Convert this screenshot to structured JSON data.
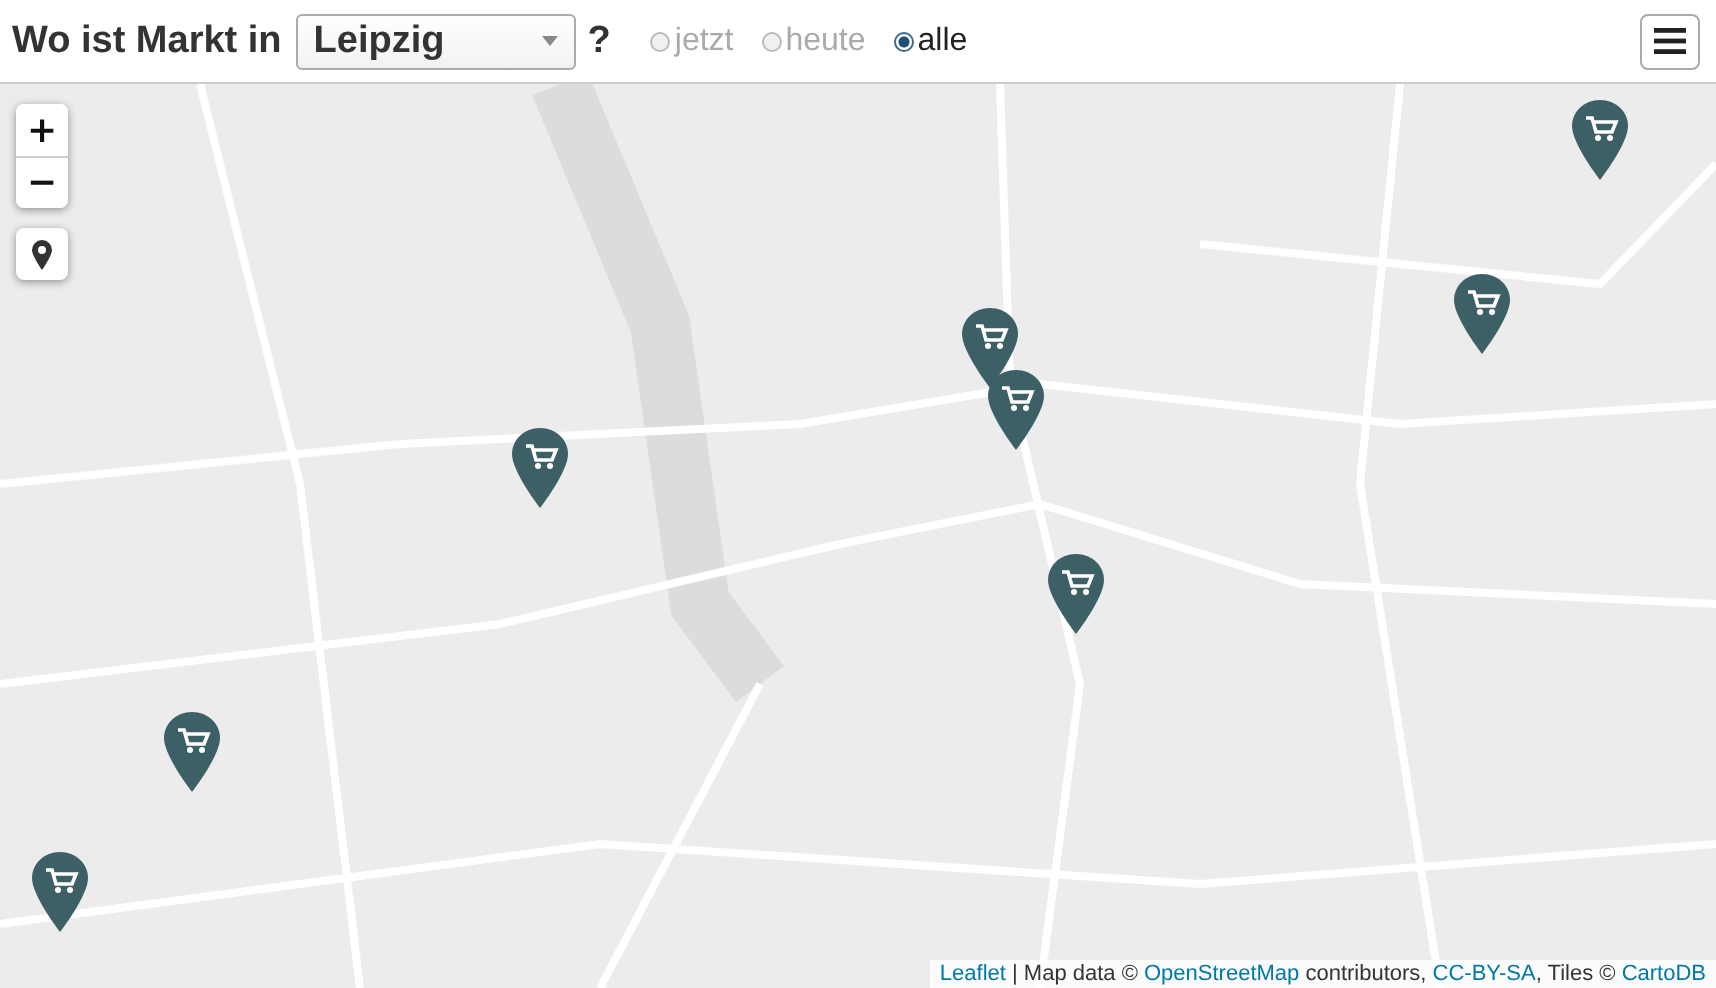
{
  "header": {
    "title": "Wo ist Markt in",
    "city_select": {
      "value": "Leipzig"
    },
    "help": "?",
    "time_filter": [
      {
        "label": "jetzt",
        "selected": false
      },
      {
        "label": "heute",
        "selected": false
      },
      {
        "label": "alle",
        "selected": true
      }
    ]
  },
  "map": {
    "zoom_in": "+",
    "zoom_out": "−",
    "attribution": [
      {
        "kind": "link",
        "text": "Leaflet"
      },
      {
        "kind": "text",
        "text": " | Map data © "
      },
      {
        "kind": "link",
        "text": "OpenStreetMap"
      },
      {
        "kind": "text",
        "text": " contributors, "
      },
      {
        "kind": "link",
        "text": "CC-BY-SA"
      },
      {
        "kind": "text",
        "text": ", Tiles © "
      },
      {
        "kind": "link",
        "text": "CartoDB"
      }
    ]
  }
}
